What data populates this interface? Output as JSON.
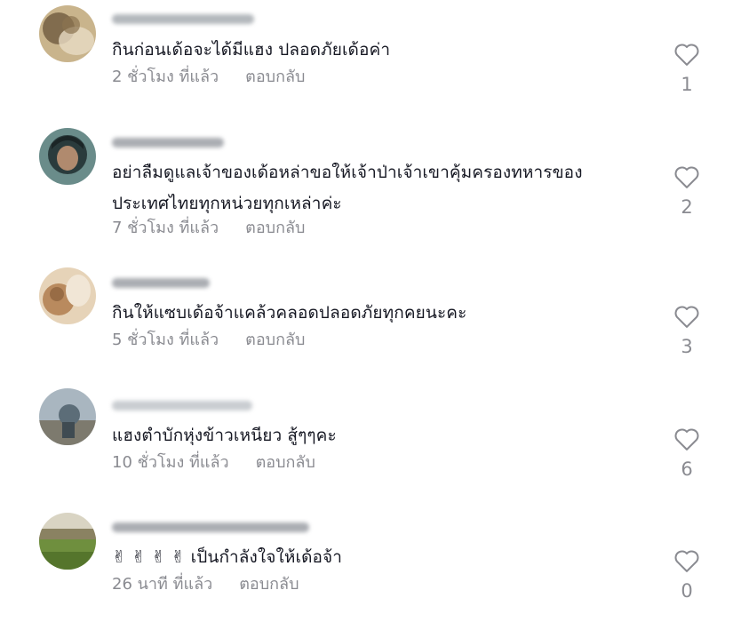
{
  "comments": [
    {
      "text": "กินก่อนเด้อจะได้มีแฮง ปลอดภัยเด้อค่า",
      "time": "2 ชั่วโมง ที่แล้ว",
      "reply": "ตอบกลับ",
      "likes": "1",
      "avatar_colors": [
        "#6f5a3f",
        "#c9b48c"
      ],
      "username_color": "#9aa0a6"
    },
    {
      "text": "อย่าลืมดูแลเจ้าของเด้อหล่าขอให้เจ้าป่าเจ้าเขาคุ้มครองทหารของประเทศไทยทุกหน่วยทุกเหล่าค่ะ",
      "time": "7 ชั่วโมง ที่แล้ว",
      "reply": "ตอบกลับ",
      "likes": "2",
      "avatar_colors": [
        "#2a3b3c",
        "#6a8c8a"
      ],
      "username_color": "#8e9299"
    },
    {
      "text": "กินให้แซบเด้อจ้าแคล้วคลอดปลอดภัยทุกคยนะคะ",
      "time": "5 ชั่วโมง ที่แล้ว",
      "reply": "ตอบกลับ",
      "likes": "3",
      "avatar_colors": [
        "#b98a5e",
        "#e6d3b8"
      ],
      "username_color": "#8e9299"
    },
    {
      "text": "แฮงตำบักหุ่งข้าวเหนียว สู้ๆๆคะ",
      "time": "10 ชั่วโมง ที่แล้ว",
      "reply": "ตอบกลับ",
      "likes": "6",
      "avatar_colors": [
        "#7d7a6e",
        "#a9b6c0"
      ],
      "username_color": "#b7bcc2"
    },
    {
      "text": "✌ ✌ ✌ ✌ เป็นกำลังใจให้เด้อจ้า",
      "time": "26 นาที ที่แล้ว",
      "reply": "ตอบกลับ",
      "likes": "0",
      "avatar_colors": [
        "#d9d4c3",
        "#6f8f3e"
      ],
      "username_color": "#8e9299"
    }
  ]
}
